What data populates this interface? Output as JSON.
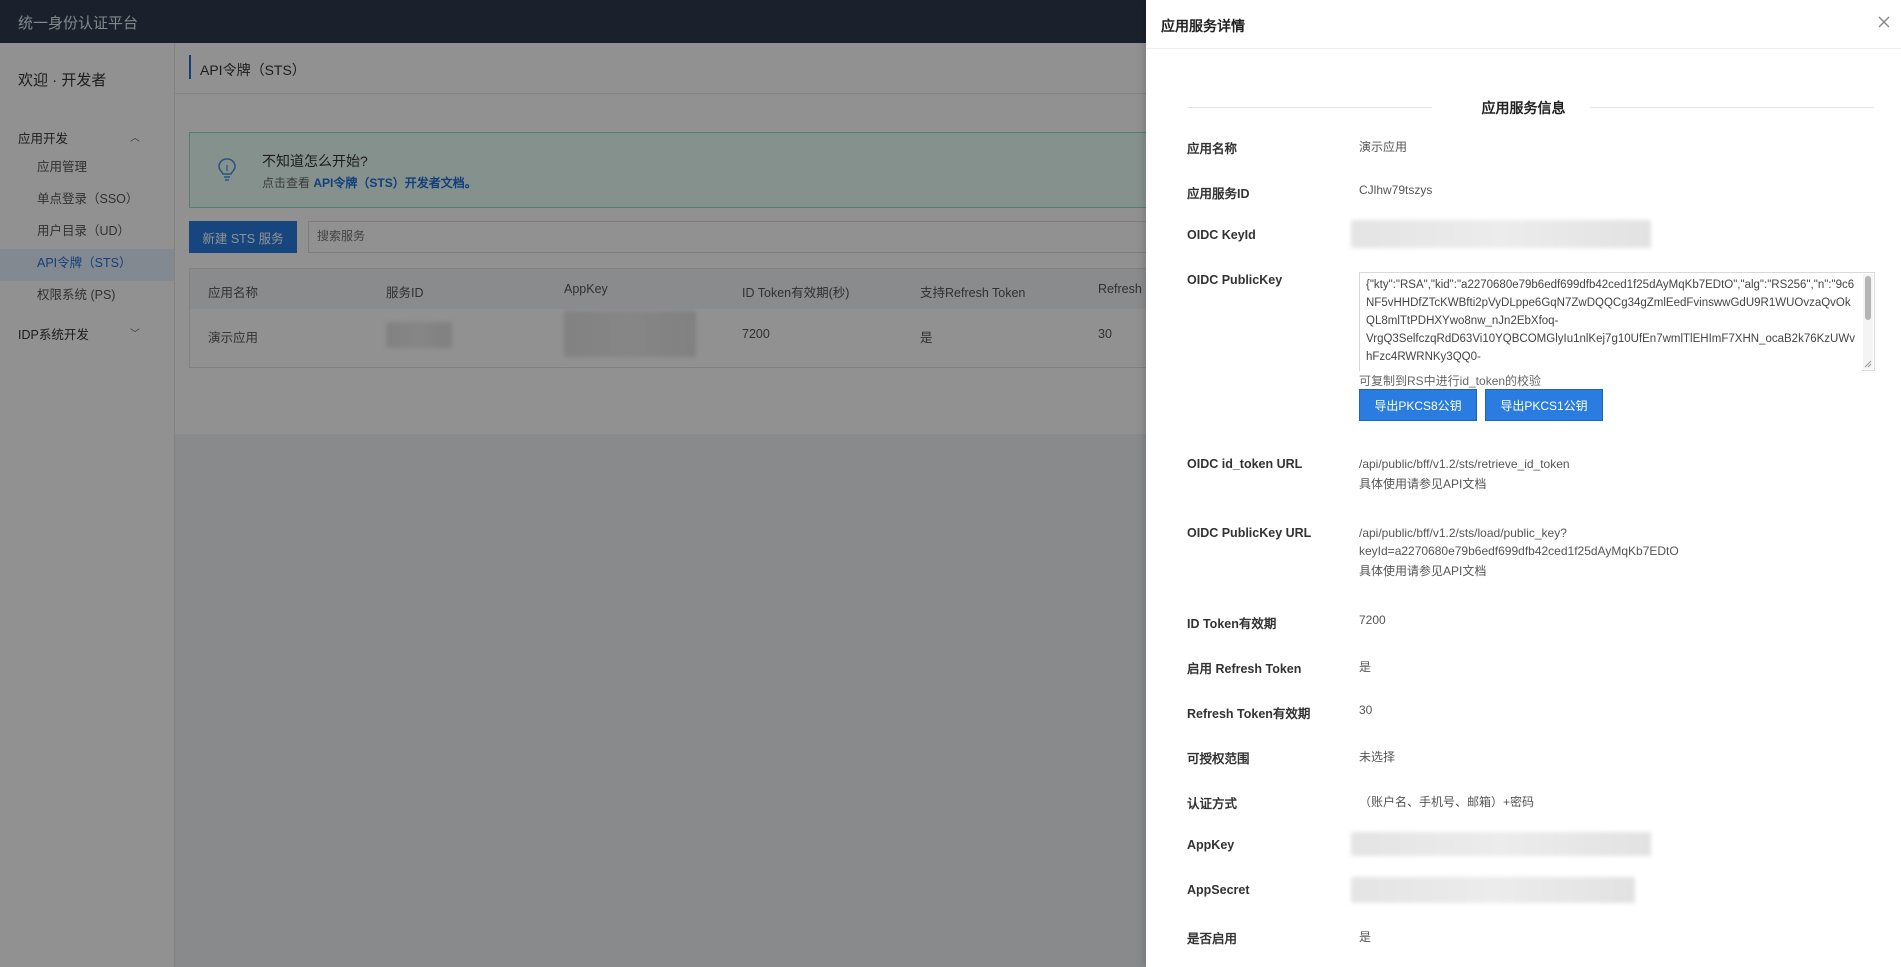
{
  "app": {
    "title": "统一身份认证平台"
  },
  "sidebar": {
    "welcome": "欢迎 · 开发者",
    "groups": [
      {
        "label": "应用开发",
        "items": [
          "应用管理",
          "单点登录（SSO）",
          "用户目录（UD）",
          "API令牌（STS）",
          "权限系统 (PS)"
        ]
      },
      {
        "label": "IDP系统开发"
      }
    ]
  },
  "page": {
    "title": "API令牌（STS）",
    "tip": {
      "title": "不知道怎么开始?",
      "prefix": "点击查看",
      "link": "API令牌（STS）开发者文档。"
    },
    "new_button": "新建 STS 服务",
    "search_placeholder": "搜索服务",
    "table": {
      "headers": [
        "应用名称",
        "服务ID",
        "AppKey",
        "ID Token有效期(秒)",
        "支持Refresh Token",
        "Refresh"
      ],
      "rows": [
        {
          "name": "演示应用",
          "ttl": "7200",
          "refresh": "是",
          "refresh_ttl": "30"
        }
      ]
    }
  },
  "drawer": {
    "title": "应用服务详情",
    "section": "应用服务信息",
    "fields": {
      "app_name": {
        "label": "应用名称",
        "value": "演示应用"
      },
      "service_id": {
        "label": "应用服务ID",
        "value": "CJlhw79tszys"
      },
      "keyid": {
        "label": "OIDC KeyId"
      },
      "pubkey": {
        "label": "OIDC PublicKey",
        "value": "{\"kty\":\"RSA\",\"kid\":\"a2270680e79b6edf699dfb42ced1f25dAyMqKb7EDtO\",\"alg\":\"RS256\",\"n\":\"9c6NF5vHHDfZTcKWBfti2pVyDLppe6GqN7ZwDQQCg34gZmlEedFvinswwGdU9R1WUOvzaQvOkQL8mlTtPDHXYwo8nw_nJn2EbXfoq-VrgQ3SelfczqRdD63Vi10YQBCOMGlyIu1nlKej7g10UfEn7wmlTlEHImF7XHN_ocaB2k76KzUWvhFzc4RWRNKy3QQ0-",
        "hint": "可复制到RS中进行id_token的校验",
        "btn_pkcs8": "导出PKCS8公钥",
        "btn_pkcs1": "导出PKCS1公钥"
      },
      "idtoken_url": {
        "label": "OIDC id_token URL",
        "value": "/api/public/bff/v1.2/sts/retrieve_id_token",
        "note": "具体使用请参见API文档"
      },
      "pubkey_url": {
        "label": "OIDC PublicKey URL",
        "value1": "/api/public/bff/v1.2/sts/load/public_key?",
        "value2": "keyId=a2270680e79b6edf699dfb42ced1f25dAyMqKb7EDtO",
        "note": "具体使用请参见API文档"
      },
      "idtoken_ttl": {
        "label": "ID Token有效期",
        "value": "7200"
      },
      "refresh_enabled": {
        "label": "启用 Refresh Token",
        "value": "是"
      },
      "refresh_ttl": {
        "label": "Refresh Token有效期",
        "value": "30"
      },
      "scope": {
        "label": "可授权范围",
        "value": "未选择"
      },
      "auth": {
        "label": "认证方式",
        "value": "（账户名、手机号、邮箱）+密码"
      },
      "appkey": {
        "label": "AppKey"
      },
      "appsecret": {
        "label": "AppSecret"
      },
      "enabled": {
        "label": "是否启用",
        "value": "是"
      }
    }
  }
}
